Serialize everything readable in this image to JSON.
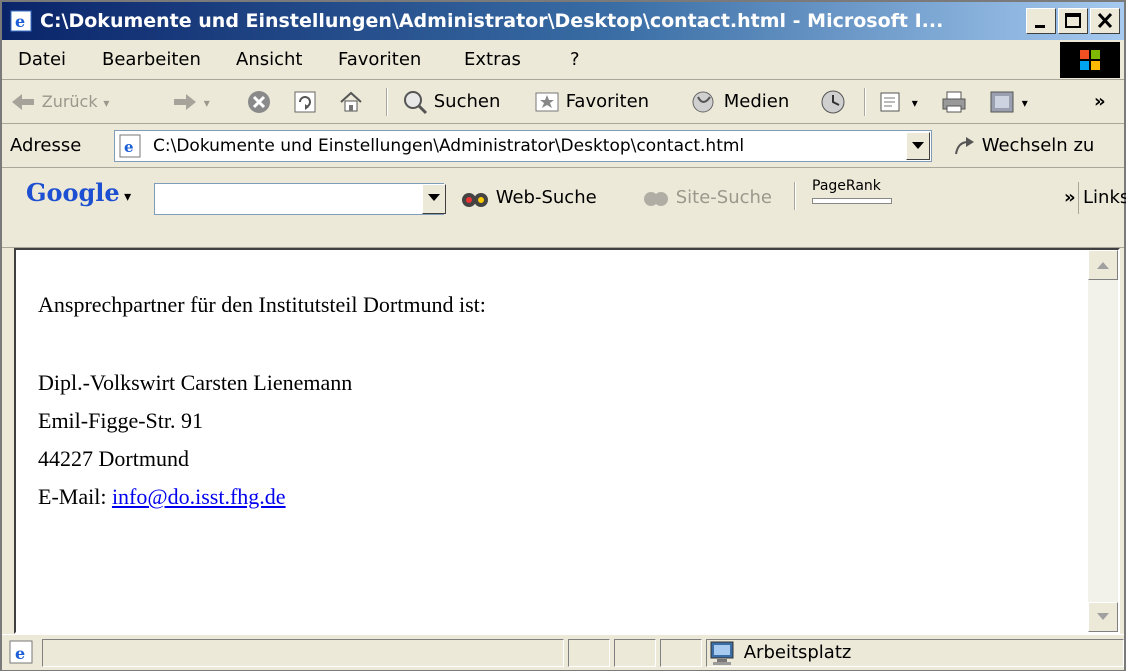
{
  "window": {
    "title": "C:\\Dokumente und Einstellungen\\Administrator\\Desktop\\contact.html - Microsoft I..."
  },
  "menu": [
    "Datei",
    "Bearbeiten",
    "Ansicht",
    "Favoriten",
    "Extras",
    "?"
  ],
  "toolbar": {
    "back_label": "Zurück",
    "search_label": "Suchen",
    "favorites_label": "Favoriten",
    "media_label": "Medien",
    "chevron": "»"
  },
  "address": {
    "label": "Adresse",
    "value": "C:\\Dokumente und Einstellungen\\Administrator\\Desktop\\contact.html",
    "go_label": "Wechseln zu"
  },
  "google": {
    "logo": "Google",
    "search_value": "",
    "web_search_label": "Web-Suche",
    "site_search_label": "Site-Suche",
    "pagerank_label": "PageRank",
    "chevron": "»",
    "links_label": "Links"
  },
  "page": {
    "intro": "Ansprechpartner für den Institutsteil Dortmund ist:",
    "name": "Dipl.-Volkswirt Carsten Lienemann",
    "street": "Emil-Figge-Str. 91",
    "city": "44227 Dortmund",
    "email_label": "E-Mail: ",
    "email": "info@do.isst.fhg.de"
  },
  "status": {
    "zone_label": "Arbeitsplatz"
  },
  "colors": {
    "titlebar_start": "#0a246a",
    "link": "#0000ee"
  }
}
